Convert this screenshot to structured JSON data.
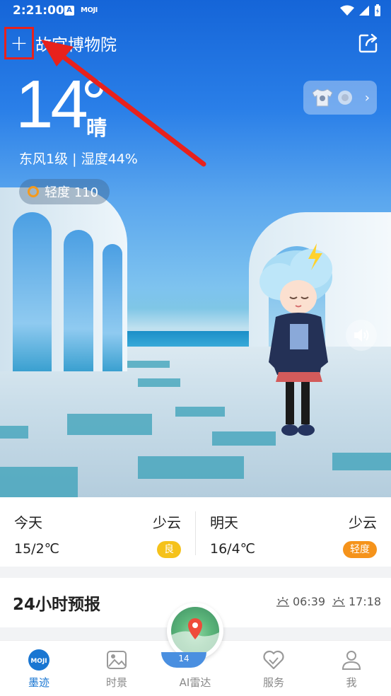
{
  "status_bar": {
    "time": "2:21:00",
    "app_icon_a": "A",
    "app_icon_moji": "MOJI"
  },
  "header": {
    "add_label": "+",
    "location": "故宫博物院"
  },
  "current": {
    "temperature": "14",
    "condition": "晴",
    "wind_humidity": "东风1级 | 湿度44%",
    "aqi_label": "轻度 110"
  },
  "forecast_days": [
    {
      "name": "今天",
      "condition": "少云",
      "temps": "15/2℃",
      "aqi": "良",
      "aqi_color": "#f5c21b"
    },
    {
      "name": "明天",
      "condition": "少云",
      "temps": "16/4℃",
      "aqi": "轻度",
      "aqi_color": "#f5931b"
    }
  ],
  "hourly": {
    "title": "24小时预报",
    "sunrise": "06:39",
    "sunset": "17:18"
  },
  "nav": {
    "items": [
      {
        "label": "墨迹",
        "icon": "moji-logo-icon"
      },
      {
        "label": "时景",
        "icon": "image-icon"
      },
      {
        "label": "AI雷达",
        "icon": "radar-map-icon"
      },
      {
        "label": "服务",
        "icon": "heart-icon"
      },
      {
        "label": "我",
        "icon": "user-icon"
      }
    ],
    "active_index": 0,
    "radar_temp": "14"
  },
  "colors": {
    "accent": "#1976d2",
    "annotation": "#e8211c"
  }
}
